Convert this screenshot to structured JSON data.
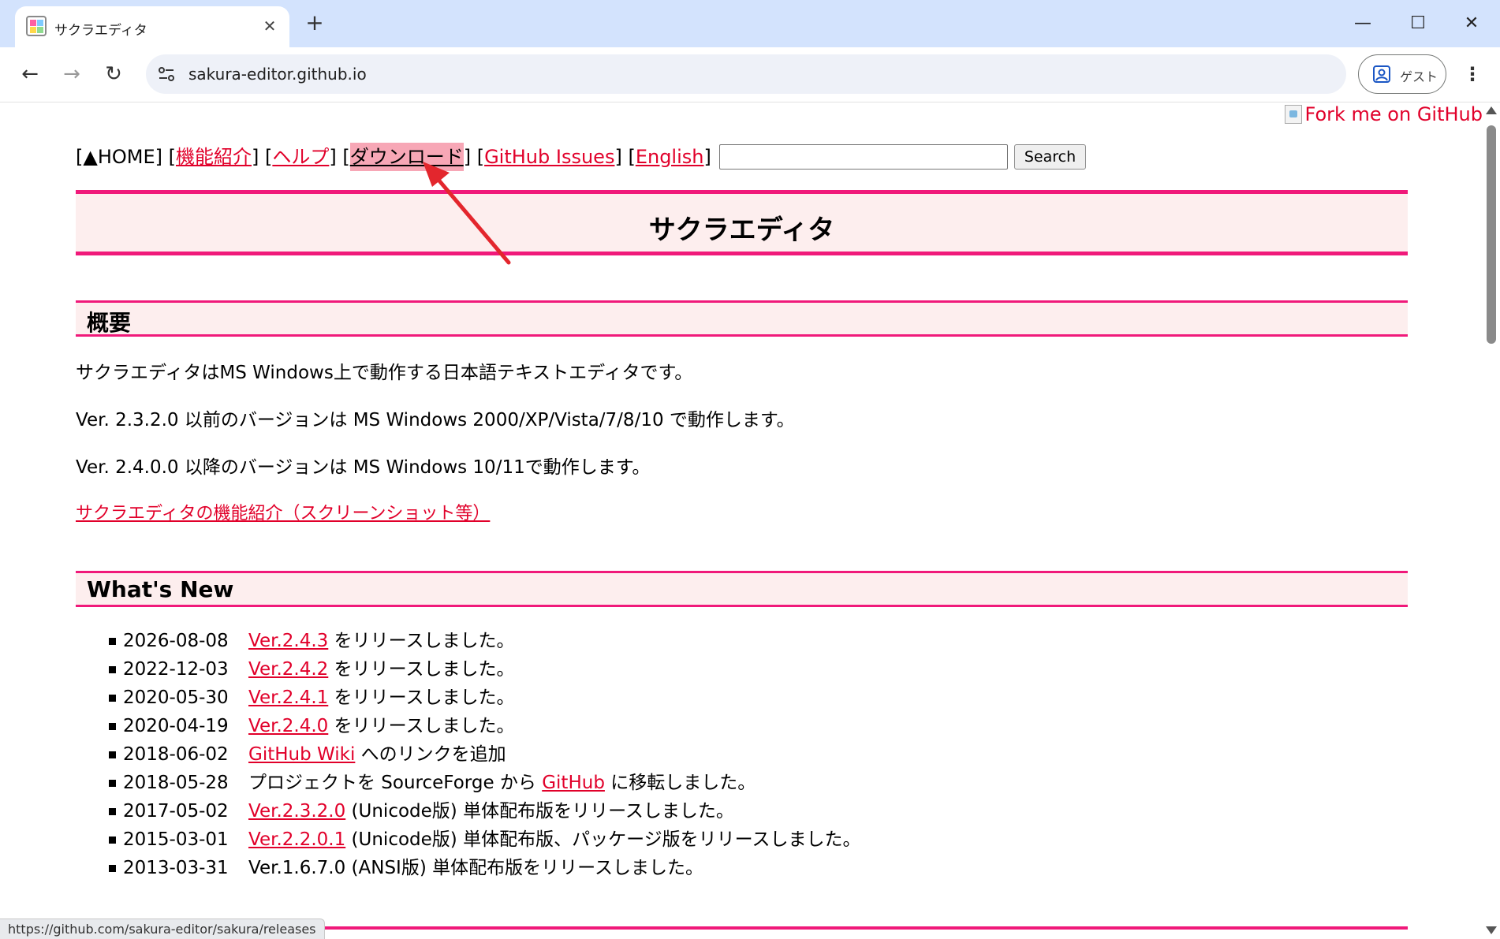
{
  "browser": {
    "tab_title": "サクラエディタ",
    "tab_close": "✕",
    "new_tab": "+",
    "minimize": "—",
    "maximize": "☐",
    "close": "✕",
    "back": "←",
    "forward": "→",
    "reload": "↻",
    "url": "sakura-editor.github.io",
    "guest_label": "ゲスト",
    "menu": "⋮",
    "status_url": "https://github.com/sakura-editor/sakura/releases"
  },
  "page": {
    "fork_text": "Fork me on GitHub",
    "nav": {
      "home": "[▲HOME]",
      "features": "機能紹介",
      "help": "ヘルプ",
      "download": "ダウンロード",
      "issues": "GitHub Issues",
      "english": "English",
      "search_value": "",
      "search_button": "Search"
    },
    "title": "サクラエディタ",
    "overview": {
      "heading": "概要",
      "p1": "サクラエディタはMS Windows上で動作する日本語テキストエディタです。",
      "p2": "Ver. 2.3.2.0 以前のバージョンは MS Windows 2000/XP/Vista/7/8/10 で動作します。",
      "p3": "Ver. 2.4.0.0 以降のバージョンは MS Windows 10/11で動作します。",
      "link": "サクラエディタの機能紹介（スクリーンショット等）"
    },
    "whats_new": {
      "heading": "What's New",
      "items": [
        {
          "date": "2026-08-08",
          "pre": "",
          "link": "Ver.2.4.3",
          "post": " をリリースしました。"
        },
        {
          "date": "2022-12-03",
          "pre": "",
          "link": "Ver.2.4.2",
          "post": " をリリースしました。"
        },
        {
          "date": "2020-05-30",
          "pre": "",
          "link": "Ver.2.4.1",
          "post": " をリリースしました。"
        },
        {
          "date": "2020-04-19",
          "pre": "",
          "link": "Ver.2.4.0",
          "post": " をリリースしました。"
        },
        {
          "date": "2018-06-02",
          "pre": "",
          "link": "GitHub Wiki",
          "post": " へのリンクを追加"
        },
        {
          "date": "2018-05-28",
          "pre": "プロジェクトを SourceForge から ",
          "link": "GitHub",
          "post": " に移転しました。"
        },
        {
          "date": "2017-05-02",
          "pre": "",
          "link": "Ver.2.3.2.0",
          "post": " (Unicode版) 単体配布版をリリースしました。"
        },
        {
          "date": "2015-03-01",
          "pre": "",
          "link": "Ver.2.2.0.1",
          "post": " (Unicode版) 単体配布版、パッケージ版をリリースしました。"
        },
        {
          "date": "2013-03-31",
          "pre": "Ver.1.6.7.0 (ANSI版) 単体配布版をリリースしました。",
          "link": "",
          "post": ""
        }
      ]
    }
  },
  "colors": {
    "accent": "#f0197a",
    "link": "#e1002a",
    "heading_bg": "#fdeeee",
    "highlight": "#f7a7b6"
  }
}
